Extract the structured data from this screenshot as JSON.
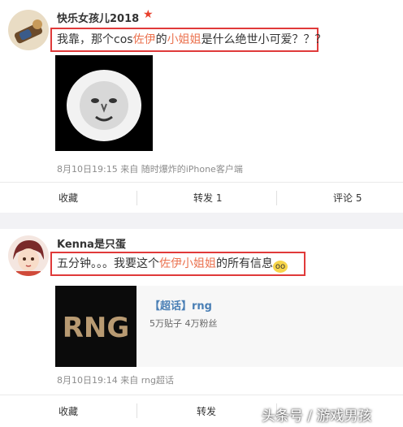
{
  "posts": [
    {
      "username": "快乐女孩儿2018",
      "content": {
        "before": "我靠，那个cos",
        "hl1": "佐伊",
        "mid": "的",
        "hl2": "小姐姐",
        "after": "是什么绝世小可爱？？？"
      },
      "meta": "8月10日19:15 来自 随时爆炸的iPhone客户端",
      "actions": {
        "favorite": "收藏",
        "repost": "转发 1",
        "comment": "评论 5"
      }
    },
    {
      "username": "Kenna是只蛋",
      "content": {
        "before": "五分钟。。。我要这个",
        "hl1": "佐伊小姐姐",
        "after": "的所有信息"
      },
      "card": {
        "title": "【超话】rng",
        "subtitle": "5万贴子 4万粉丝",
        "logo_text": "RNG"
      },
      "meta": "8月10日19:14 来自 rng超话",
      "actions": {
        "favorite": "收藏",
        "repost": "转发"
      }
    }
  ],
  "watermark": "头条号 / 游戏男孩",
  "colors": {
    "highlight": "#eb7350",
    "box": "#e03a3a",
    "link": "#4a7fb5",
    "star": "#e8402d"
  }
}
